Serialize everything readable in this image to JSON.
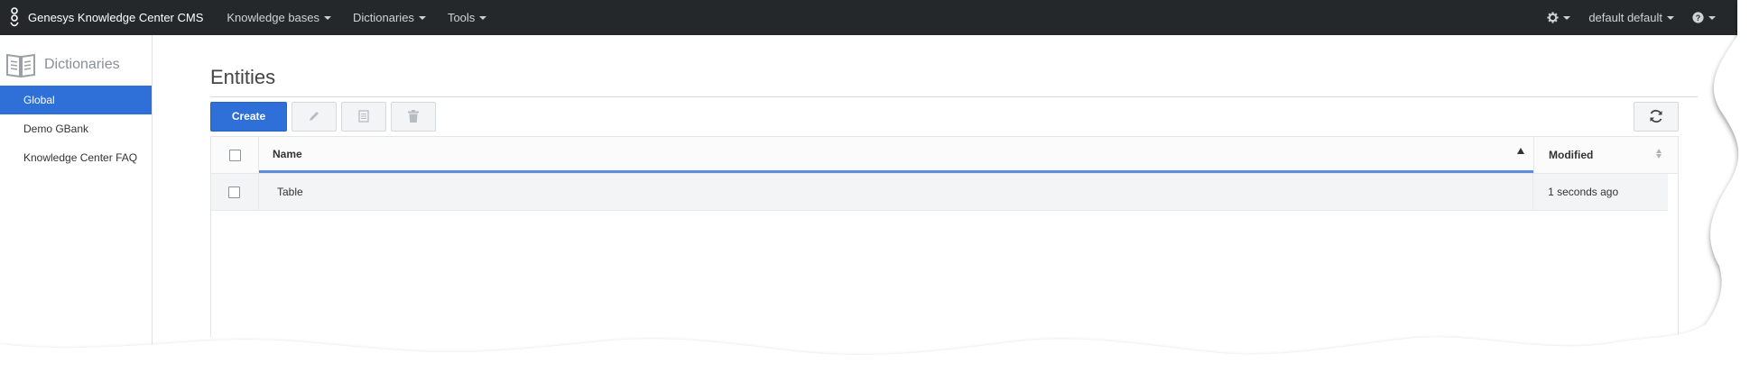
{
  "navbar": {
    "brand": "Genesys Knowledge Center CMS",
    "menus": [
      "Knowledge bases",
      "Dictionaries",
      "Tools"
    ],
    "settings_icon": "gear-icon",
    "user": "default default",
    "help_icon": "question-circle-icon"
  },
  "sidebar": {
    "header": "Dictionaries",
    "items": [
      {
        "label": "Global",
        "active": true
      },
      {
        "label": "Demo GBank",
        "active": false
      },
      {
        "label": "Knowledge Center FAQ",
        "active": false
      }
    ]
  },
  "main": {
    "title": "Entities",
    "toolbar": {
      "create_label": "Create",
      "icons": [
        "pencil-icon",
        "copy-document-icon",
        "trash-icon",
        "refresh-icon"
      ]
    },
    "table": {
      "columns": [
        "Name",
        "Modified"
      ],
      "rows": [
        {
          "name": "Table",
          "modified": "1 seconds ago"
        }
      ]
    }
  },
  "colors": {
    "navbar": "#25282b",
    "accent": "#2e6fd8"
  }
}
